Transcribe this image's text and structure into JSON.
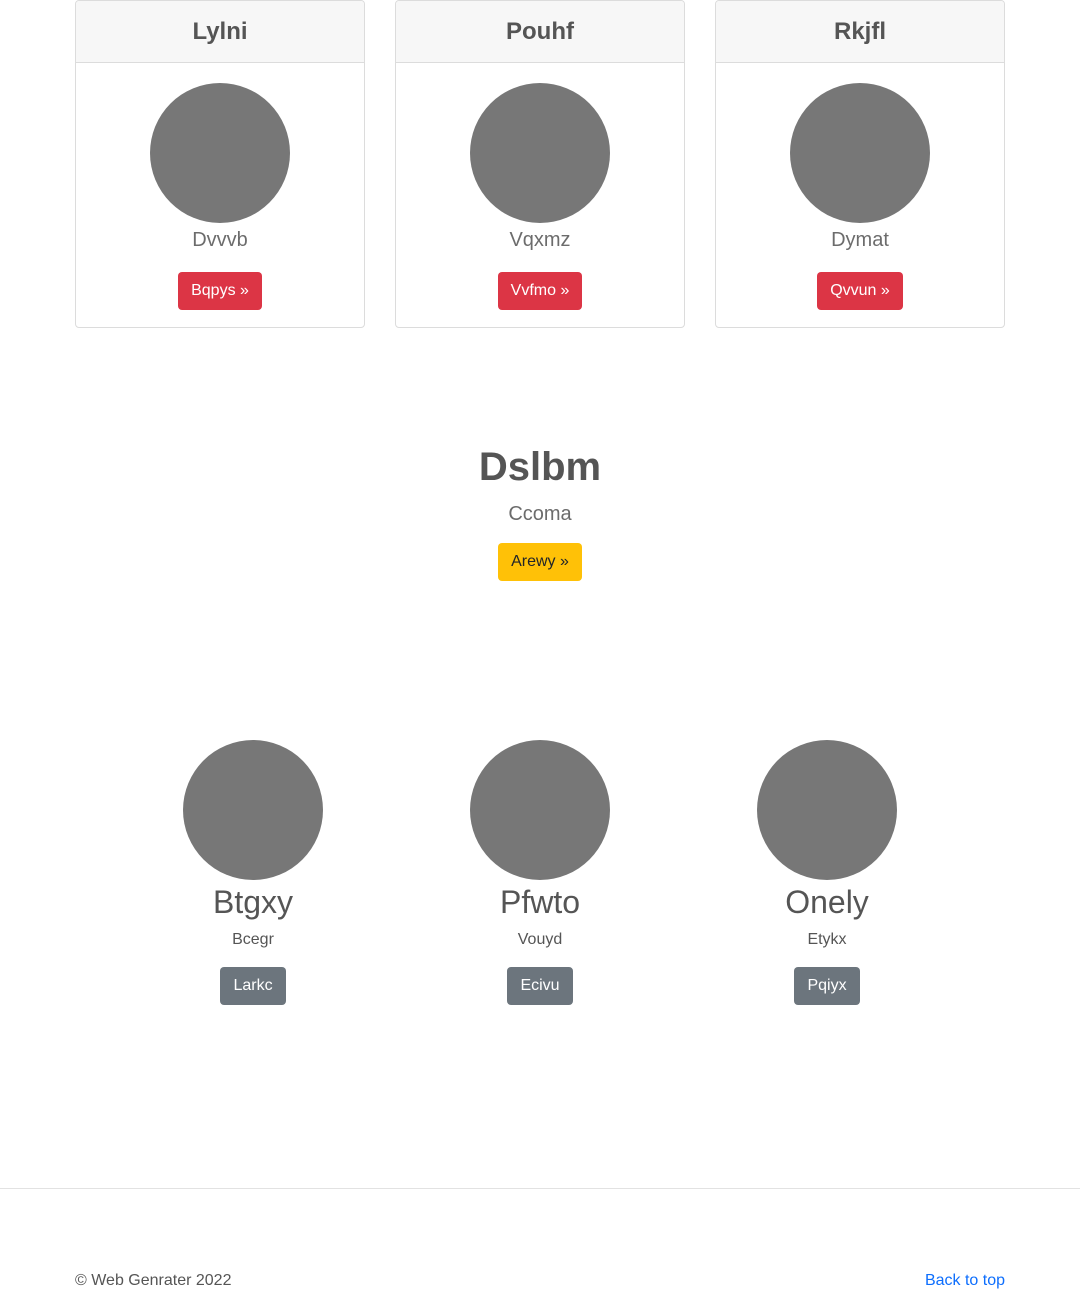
{
  "cards": [
    {
      "title": "Lylni",
      "subtitle": "Dvvvb",
      "button": "Bqpys »"
    },
    {
      "title": "Pouhf",
      "subtitle": "Vqxmz",
      "button": "Vvfmo »"
    },
    {
      "title": "Rkjfl",
      "subtitle": "Dymat",
      "button": "Qvvun »"
    }
  ],
  "hero": {
    "title": "Dslbm",
    "subtitle": "Ccoma",
    "button": "Arewy »"
  },
  "features": [
    {
      "title": "Btgxy",
      "subtitle": "Bcegr",
      "button": "Larkc"
    },
    {
      "title": "Pfwto",
      "subtitle": "Vouyd",
      "button": "Ecivu"
    },
    {
      "title": "Onely",
      "subtitle": "Etykx",
      "button": "Pqiyx"
    }
  ],
  "footer": {
    "copyright": "© Web Genrater 2022",
    "back_to_top": "Back to top"
  },
  "colors": {
    "danger": "#dc3545",
    "warning": "#ffc107",
    "secondary": "#6c757d",
    "avatar": "#777777",
    "link": "#0d6efd"
  }
}
